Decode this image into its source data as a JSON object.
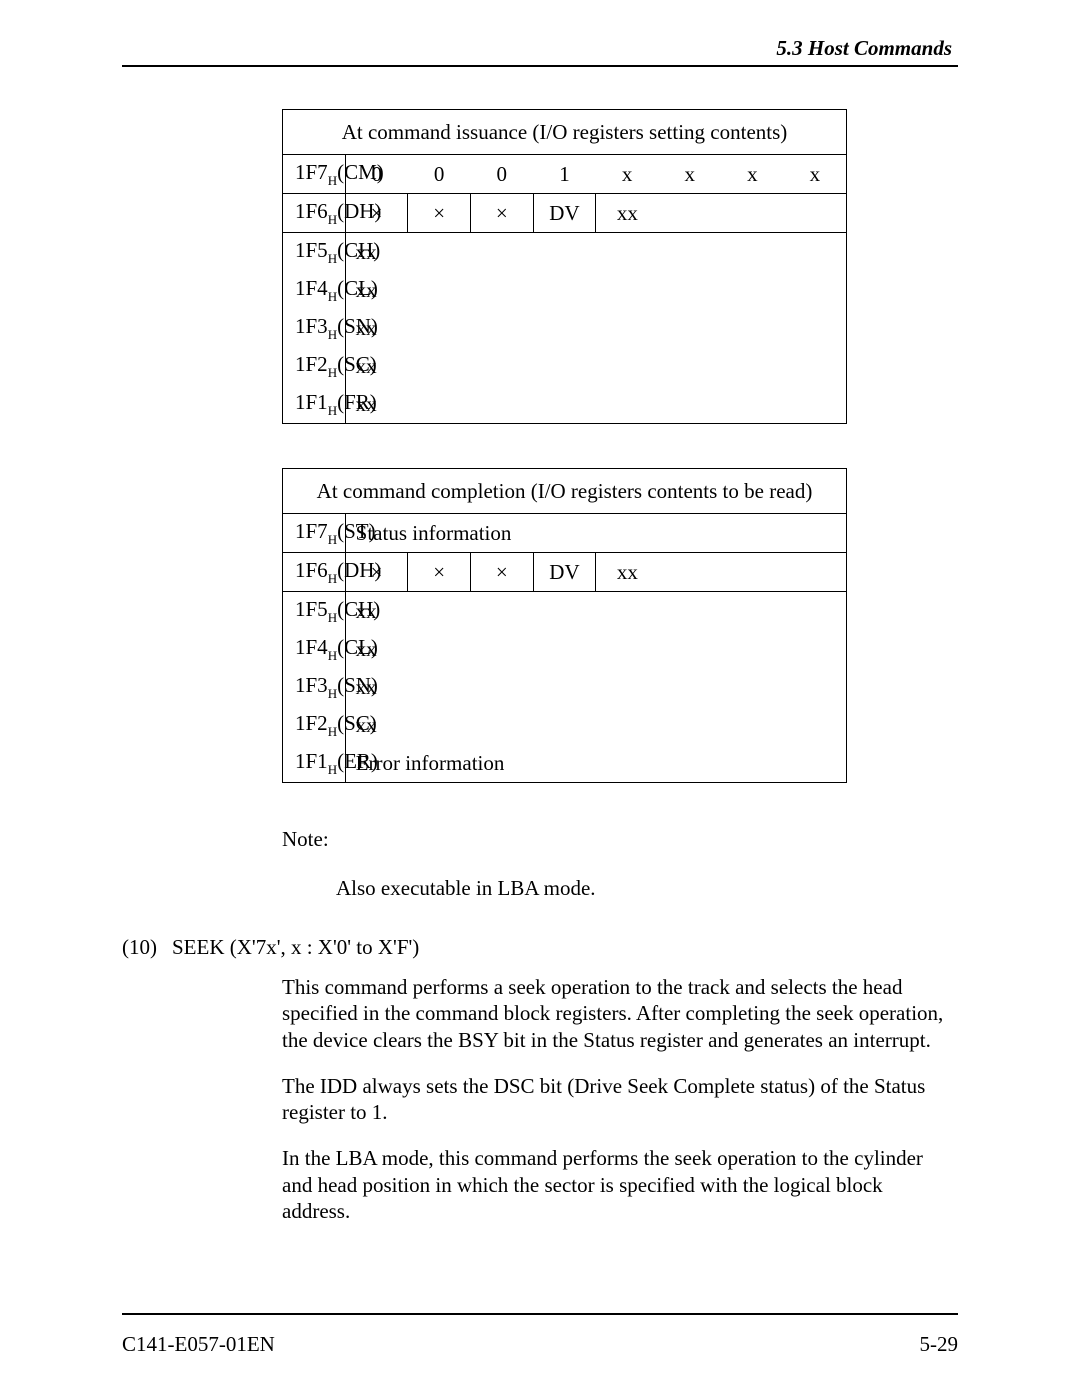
{
  "header": {
    "section": "5.3  Host Commands"
  },
  "table1": {
    "title": "At command issuance (I/O registers setting contents)",
    "rows": {
      "cm": {
        "label_pre": "1F7",
        "label_sub": "H",
        "label_post": "(CM)",
        "b": [
          "0",
          "0",
          "0",
          "1",
          "x",
          "x",
          "x",
          "x"
        ]
      },
      "dh": {
        "label_pre": "1F6",
        "label_sub": "H",
        "label_post": "(DH)",
        "b": [
          "×",
          "×",
          "×",
          "DV",
          "xx",
          "",
          "",
          ""
        ]
      },
      "ch": {
        "label_pre": "1F5",
        "label_sub": "H",
        "label_post": "(CH)",
        "val": "xx"
      },
      "cl": {
        "label_pre": "1F4",
        "label_sub": "H",
        "label_post": "(CL)",
        "val": "xx"
      },
      "sn": {
        "label_pre": "1F3",
        "label_sub": "H",
        "label_post": "(SN)",
        "val": "xx"
      },
      "sc": {
        "label_pre": "1F2",
        "label_sub": "H",
        "label_post": "(SC)",
        "val": "xx"
      },
      "fr": {
        "label_pre": "1F1",
        "label_sub": "H",
        "label_post": "(FR)",
        "val": "xx"
      }
    }
  },
  "table2": {
    "title": "At command completion (I/O registers contents to be read)",
    "rows": {
      "st": {
        "label_pre": "1F7",
        "label_sub": "H",
        "label_post": "(ST)",
        "val": "Status information"
      },
      "dh": {
        "label_pre": "1F6",
        "label_sub": "H",
        "label_post": "(DH)",
        "b": [
          "×",
          "×",
          "×",
          "DV",
          "xx",
          "",
          "",
          ""
        ]
      },
      "ch": {
        "label_pre": "1F5",
        "label_sub": "H",
        "label_post": "(CH)",
        "val": "xx"
      },
      "cl": {
        "label_pre": "1F4",
        "label_sub": "H",
        "label_post": "(CL)",
        "val": "xx"
      },
      "sn": {
        "label_pre": "1F3",
        "label_sub": "H",
        "label_post": "(SN)",
        "val": "xx"
      },
      "sc": {
        "label_pre": "1F2",
        "label_sub": "H",
        "label_post": "(SC)",
        "val": "xx"
      },
      "er": {
        "label_pre": "1F1",
        "label_sub": "H",
        "label_post": "(ER)",
        "val": "Error information"
      }
    }
  },
  "note": {
    "label": "Note:",
    "body": "Also executable in LBA mode."
  },
  "section": {
    "num": "(10)",
    "title": "SEEK (X'7x', x : X'0' to X'F')"
  },
  "paras": {
    "p1": "This command performs a seek operation to the track and selects the head specified in the command block registers.  After completing the seek operation, the device clears the BSY bit in the Status register and generates an interrupt.",
    "p2": "The IDD always sets the DSC bit (Drive Seek Complete status) of the Status register to 1.",
    "p3": "In the LBA mode, this command performs the seek operation to the cylinder and head position in which the sector is specified with the logical block address."
  },
  "footer": {
    "left": "C141-E057-01EN",
    "right": "5-29"
  }
}
